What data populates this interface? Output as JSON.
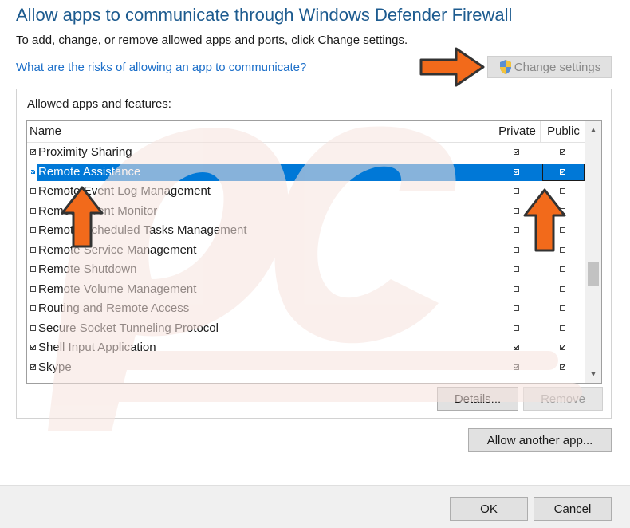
{
  "header": {
    "title": "Allow apps to communicate through Windows Defender Firewall",
    "subtitle": "To add, change, or remove allowed apps and ports, click Change settings.",
    "risk_link": "What are the risks of allowing an app to communicate?",
    "change_settings_label": "Change settings",
    "change_settings_icon": "uac-shield-icon"
  },
  "group": {
    "label": "Allowed apps and features:",
    "columns": {
      "name": "Name",
      "private": "Private",
      "public": "Public"
    },
    "rows": [
      {
        "name": "Proximity Sharing",
        "enabled": true,
        "private": true,
        "public": true,
        "selected": false
      },
      {
        "name": "Remote Assistance",
        "enabled": true,
        "private": true,
        "public": true,
        "selected": true
      },
      {
        "name": "Remote Event Log Management",
        "enabled": false,
        "private": false,
        "public": false,
        "selected": false
      },
      {
        "name": "Remote Event Monitor",
        "enabled": false,
        "private": false,
        "public": false,
        "selected": false
      },
      {
        "name": "Remote Scheduled Tasks Management",
        "enabled": false,
        "private": false,
        "public": false,
        "selected": false
      },
      {
        "name": "Remote Service Management",
        "enabled": false,
        "private": false,
        "public": false,
        "selected": false
      },
      {
        "name": "Remote Shutdown",
        "enabled": false,
        "private": false,
        "public": false,
        "selected": false
      },
      {
        "name": "Remote Volume Management",
        "enabled": false,
        "private": false,
        "public": false,
        "selected": false
      },
      {
        "name": "Routing and Remote Access",
        "enabled": false,
        "private": false,
        "public": false,
        "selected": false
      },
      {
        "name": "Secure Socket Tunneling Protocol",
        "enabled": false,
        "private": false,
        "public": false,
        "selected": false
      },
      {
        "name": "Shell Input Application",
        "enabled": true,
        "private": true,
        "public": true,
        "selected": false
      },
      {
        "name": "Skype",
        "enabled": true,
        "private": true,
        "public": true,
        "selected": false
      }
    ],
    "details_label": "Details...",
    "remove_label": "Remove"
  },
  "allow_another_label": "Allow another app...",
  "footer": {
    "ok_label": "OK",
    "cancel_label": "Cancel"
  },
  "colors": {
    "title": "#1d5b8f",
    "link": "#1c6fc9",
    "selection": "#0078d7",
    "annotation_arrow": "#f26a1b"
  }
}
